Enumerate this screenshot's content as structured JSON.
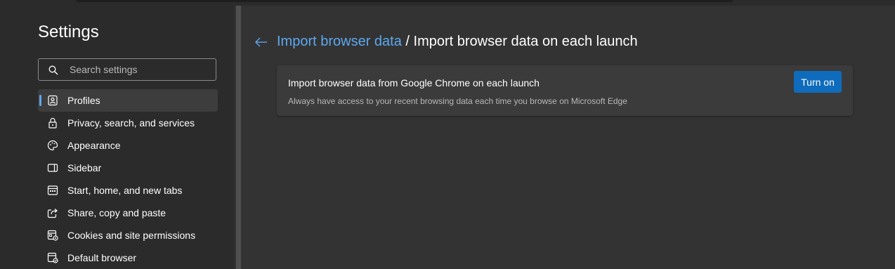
{
  "settings_title": "Settings",
  "search": {
    "placeholder": "Search settings"
  },
  "nav_items": [
    {
      "label": "Profiles",
      "icon": "profile-icon",
      "active": true
    },
    {
      "label": "Privacy, search, and services",
      "icon": "lock-icon"
    },
    {
      "label": "Appearance",
      "icon": "palette-icon"
    },
    {
      "label": "Sidebar",
      "icon": "sidebar-icon"
    },
    {
      "label": "Start, home, and new tabs",
      "icon": "home-tabs-icon"
    },
    {
      "label": "Share, copy and paste",
      "icon": "share-icon"
    },
    {
      "label": "Cookies and site permissions",
      "icon": "cookies-icon"
    },
    {
      "label": "Default browser",
      "icon": "browser-icon"
    }
  ],
  "breadcrumb": {
    "parent": "Import browser data",
    "separator": " / ",
    "current": "Import browser data on each launch"
  },
  "card": {
    "heading": "Import browser data from Google Chrome on each launch",
    "description": "Always have access to your recent browsing data each time you browse on Microsoft Edge",
    "button_label": "Turn on"
  },
  "colors": {
    "accent": "#5ca8f0",
    "button": "#0f6cbd",
    "background": "#333333",
    "sidebar": "#2b2b2b",
    "card": "#3b3b3b"
  }
}
